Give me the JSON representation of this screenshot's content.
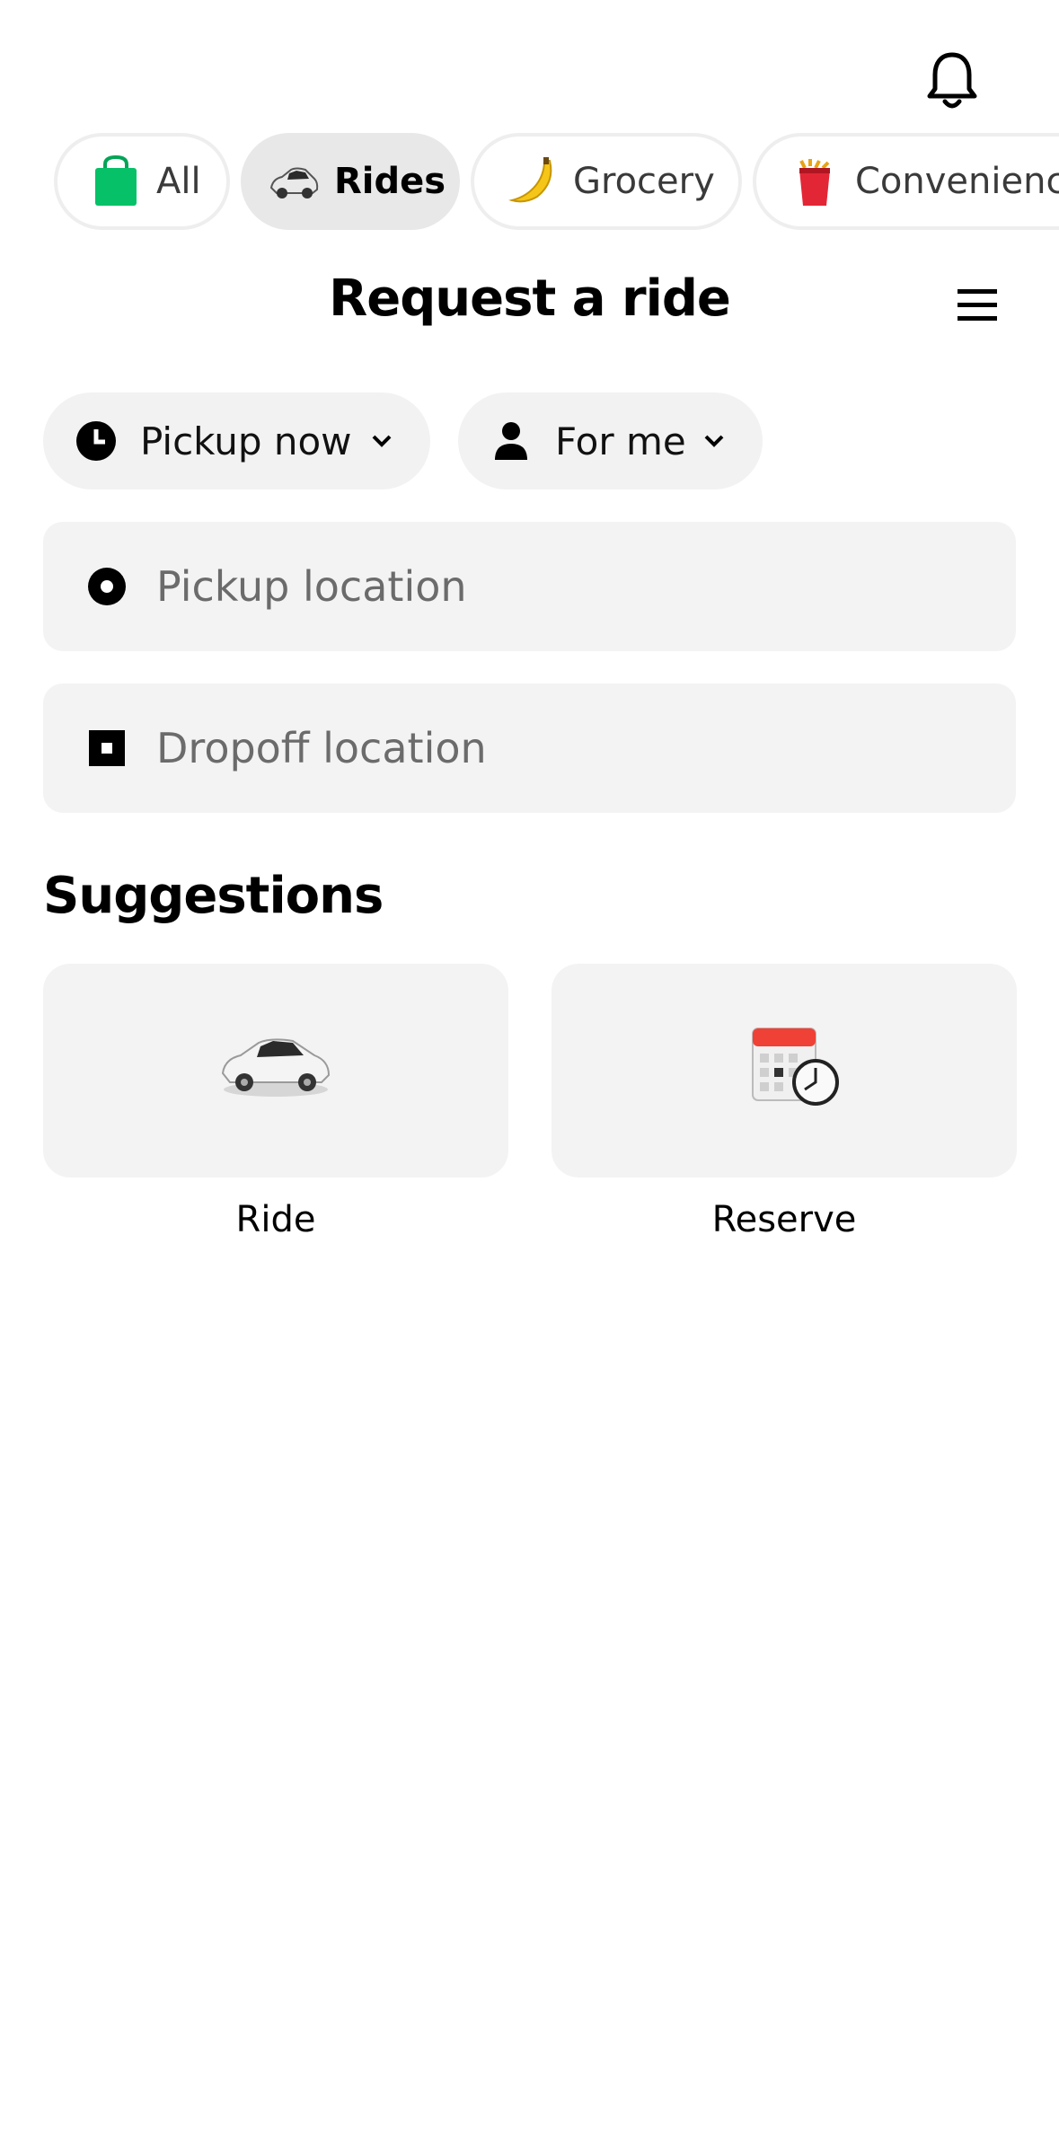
{
  "header": {
    "bell_icon": "bell-icon"
  },
  "tabs": [
    {
      "label": "All",
      "icon": "shopping-bag-icon",
      "active": false
    },
    {
      "label": "Rides",
      "icon": "car-icon",
      "active": true
    },
    {
      "label": "Grocery",
      "icon": "banana-icon",
      "active": false
    },
    {
      "label": "Convenience",
      "icon": "snack-icon",
      "active": false
    }
  ],
  "page": {
    "title": "Request a ride",
    "menu_icon": "hamburger-menu-icon"
  },
  "options": {
    "pickup_time": "Pickup now",
    "rider": "For me"
  },
  "inputs": {
    "pickup_placeholder": "Pickup location",
    "dropoff_placeholder": "Dropoff location"
  },
  "suggestions": {
    "title": "Suggestions",
    "items": [
      {
        "label": "Ride",
        "icon": "car-icon"
      },
      {
        "label": "Reserve",
        "icon": "calendar-clock-icon"
      }
    ]
  },
  "colors": {
    "accent_green": "#06C167",
    "chip_bg": "#F2F2F2",
    "field_bg": "#F3F3F3"
  }
}
